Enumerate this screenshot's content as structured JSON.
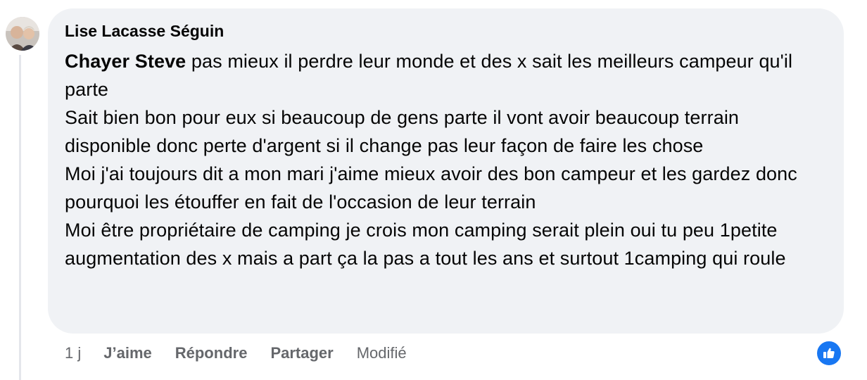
{
  "comment": {
    "author": "Lise Lacasse Séguin",
    "mention": "Chayer Steve",
    "lines": [
      " pas mieux il perdre leur monde et des x sait les meilleurs campeur qu'il parte",
      "Sait bien bon pour eux si beaucoup de gens parte il vont avoir beaucoup terrain disponible donc perte d'argent si il change pas leur façon de faire les chose",
      "Moi j'ai toujours dit a mon mari j'aime mieux avoir des bon campeur et les gardez donc pourquoi les étouffer en fait de l'occasion de leur terrain",
      "Moi être propriétaire de camping je crois mon camping serait plein oui tu peu 1petite augmentation des x mais a part ça la pas a tout les ans et surtout 1camping qui roule"
    ]
  },
  "actions": {
    "time": "1 j",
    "like": "J’aime",
    "reply": "Répondre",
    "share": "Partager",
    "edited": "Modifié"
  },
  "reaction": {
    "icon": "thumbs-up-icon",
    "color": "#1877f2"
  }
}
